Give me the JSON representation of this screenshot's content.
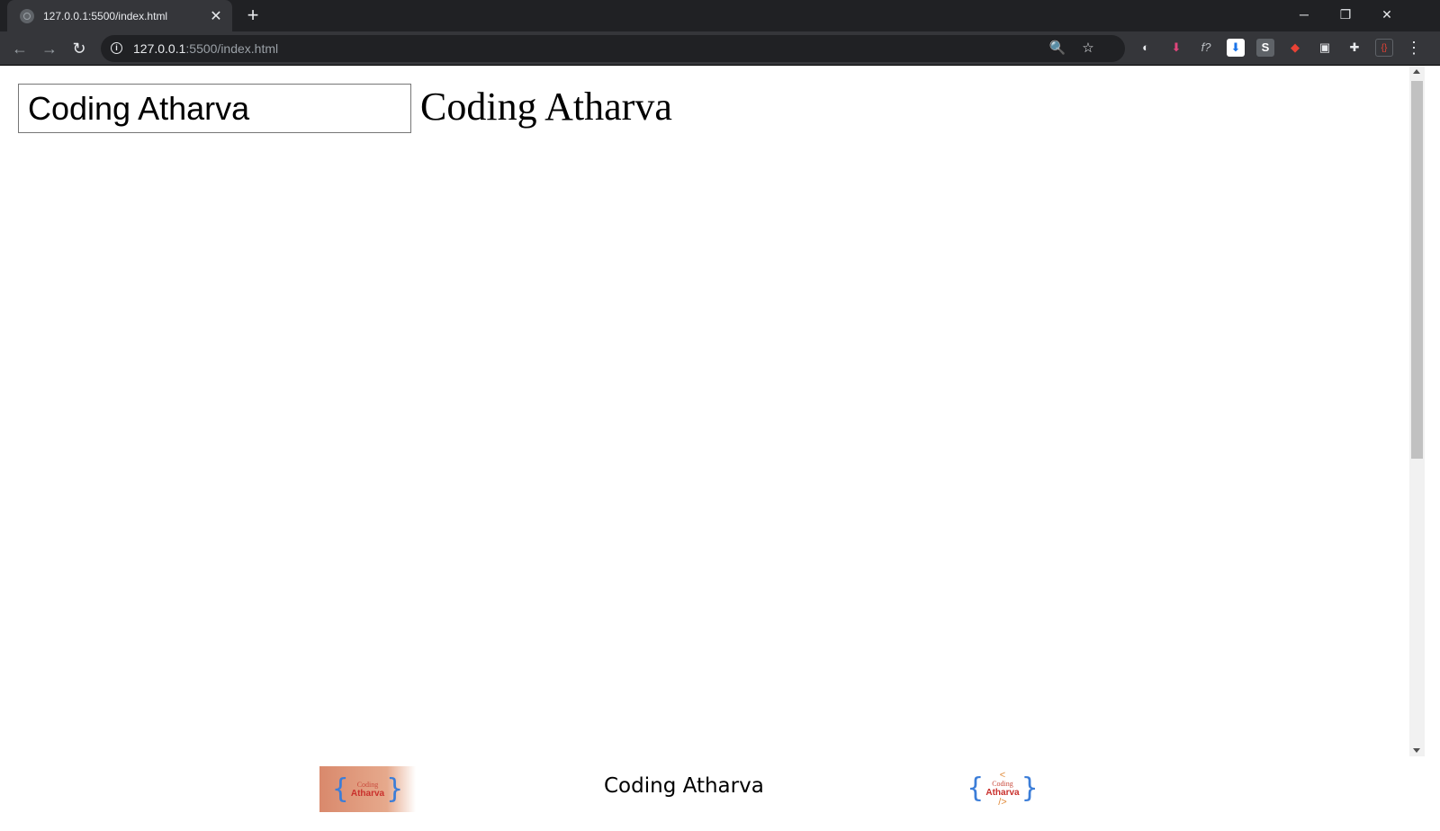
{
  "browser": {
    "tab_title": "127.0.0.1:5500/index.html",
    "tab_close": "✕",
    "new_tab": "+",
    "url_host": "127.0.0.1",
    "url_path": ":5500/index.html",
    "window_controls": {
      "minimize": "─",
      "maximize": "❐",
      "close": "✕"
    },
    "nav": {
      "back": "←",
      "forward": "→",
      "reload": "↻"
    },
    "icons": {
      "zoom": "🔍",
      "star": "☆",
      "menu": "⋮",
      "puzzle": "✚"
    }
  },
  "extensions": [
    {
      "name": "ext-1",
      "glyph": "◐"
    },
    {
      "name": "ext-2",
      "glyph": "⬇"
    },
    {
      "name": "ext-3",
      "glyph": "f?"
    },
    {
      "name": "ext-4",
      "glyph": "⬇"
    },
    {
      "name": "ext-5",
      "glyph": "S"
    },
    {
      "name": "ext-6",
      "glyph": "◆"
    },
    {
      "name": "ext-7",
      "glyph": "▣"
    }
  ],
  "page": {
    "input_value": "Coding Atharva",
    "heading": "Coding Atharva"
  },
  "footer": {
    "text": "Coding Atharva",
    "logo_left": {
      "brace_open": "{",
      "small": "Coding",
      "big": "Atharva",
      "brace_close": "}"
    },
    "logo_right": {
      "tag_open": "<",
      "brace_open": "{",
      "small": "Coding",
      "big": "Atharva",
      "brace_close": "}",
      "tag_close": "/>"
    }
  }
}
